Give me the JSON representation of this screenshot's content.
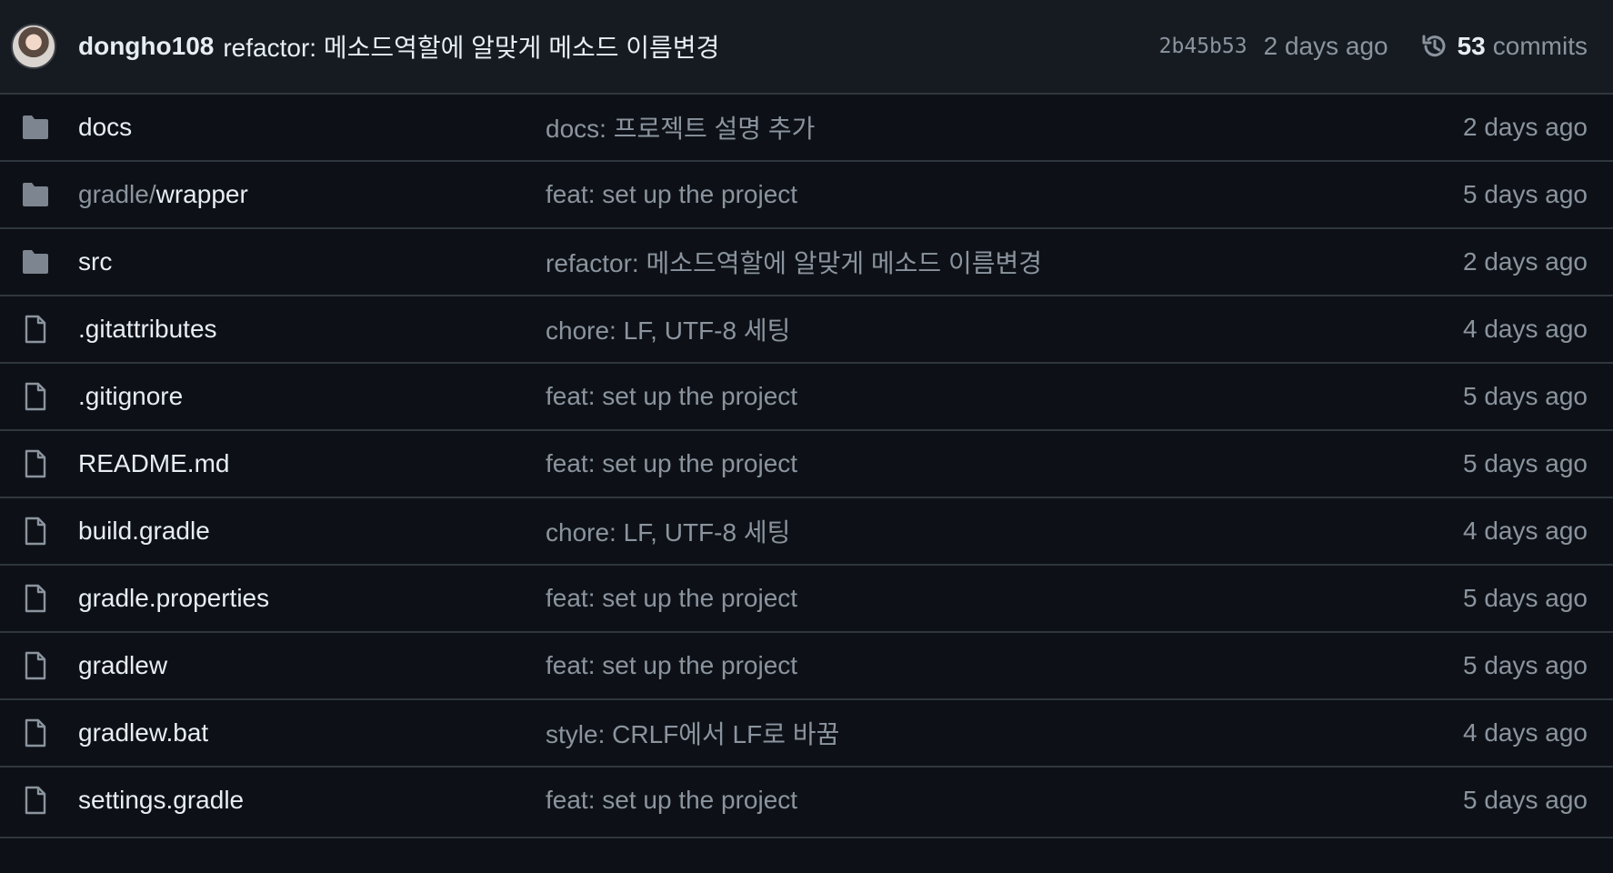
{
  "latest_commit": {
    "author": "dongho108",
    "message": "refactor: 메소드역할에 알맞게 메소드 이름변경",
    "sha": "2b45b53",
    "time": "2 days ago",
    "commit_count": "53",
    "commits_label": "commits"
  },
  "files": [
    {
      "type": "folder",
      "name_prefix": "",
      "name": "docs",
      "message": "docs: 프로젝트 설명 추가",
      "age": "2 days ago"
    },
    {
      "type": "folder",
      "name_prefix": "gradle/",
      "name": "wrapper",
      "message": "feat: set up the project",
      "age": "5 days ago"
    },
    {
      "type": "folder",
      "name_prefix": "",
      "name": "src",
      "message": "refactor: 메소드역할에 알맞게 메소드 이름변경",
      "age": "2 days ago"
    },
    {
      "type": "file",
      "name_prefix": "",
      "name": ".gitattributes",
      "message": "chore: LF, UTF-8 세팅",
      "age": "4 days ago"
    },
    {
      "type": "file",
      "name_prefix": "",
      "name": ".gitignore",
      "message": "feat: set up the project",
      "age": "5 days ago"
    },
    {
      "type": "file",
      "name_prefix": "",
      "name": "README.md",
      "message": "feat: set up the project",
      "age": "5 days ago"
    },
    {
      "type": "file",
      "name_prefix": "",
      "name": "build.gradle",
      "message": "chore: LF, UTF-8 세팅",
      "age": "4 days ago"
    },
    {
      "type": "file",
      "name_prefix": "",
      "name": "gradle.properties",
      "message": "feat: set up the project",
      "age": "5 days ago"
    },
    {
      "type": "file",
      "name_prefix": "",
      "name": "gradlew",
      "message": "feat: set up the project",
      "age": "5 days ago"
    },
    {
      "type": "file",
      "name_prefix": "",
      "name": "gradlew.bat",
      "message": "style: CRLF에서 LF로 바꿈",
      "age": "4 days ago"
    },
    {
      "type": "file",
      "name_prefix": "",
      "name": "settings.gradle",
      "message": "feat: set up the project",
      "age": "5 days ago"
    }
  ],
  "icons": {
    "folder": "folder-icon",
    "file": "file-icon",
    "history": "history-icon"
  },
  "colors": {
    "background": "#0d1117",
    "header_background": "#161b22",
    "border": "#30363d",
    "primary_text": "#e6edf3",
    "muted_text": "#8b949e",
    "folder_icon": "#7d8590"
  }
}
